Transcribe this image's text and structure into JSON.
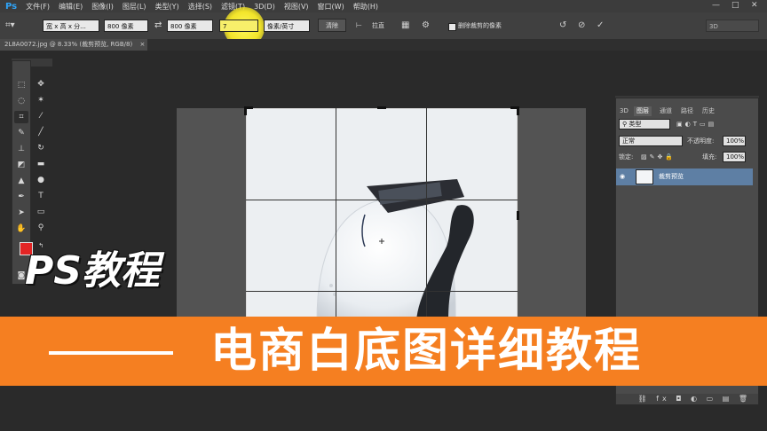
{
  "app": {
    "logo": "Ps"
  },
  "menu": [
    "文件(F)",
    "编辑(E)",
    "图像(I)",
    "图层(L)",
    "类型(Y)",
    "选择(S)",
    "滤镜(T)",
    "3D(D)",
    "视图(V)",
    "窗口(W)",
    "帮助(H)"
  ],
  "window_controls": {
    "minimize": "—",
    "maximize": "□",
    "close": "✕"
  },
  "options": {
    "ratio_select": "宽 x 高 x 分...",
    "width_value": "800 像素",
    "height_value": "800 像素",
    "resolution_value": "7",
    "unit_select": "像素/英寸",
    "clear_button": "清除",
    "straighten_label": "拉直",
    "delete_cropped_label": "删除裁剪的像素",
    "mode_3d": "3D"
  },
  "document_tab": {
    "title": "2L8A0072.jpg @ 8.33% (裁剪预览, RGB/8)",
    "close": "×"
  },
  "layers_panel": {
    "tabs": [
      "3D",
      "图层",
      "通道",
      "路径",
      "历史"
    ],
    "filter_label": "类型",
    "blend_mode": "正常",
    "opacity_label": "不透明度:",
    "opacity_value": "100%",
    "lock_label": "锁定:",
    "fill_label": "填充:",
    "fill_value": "100%",
    "layer_name": "裁剪预览",
    "bottom_icons": "⛓ fx ◘ ◐ ▭ ▤ 🗑"
  },
  "overlay": {
    "title": "PS教程",
    "banner_text": "电商白底图详细教程",
    "banner_color": "#f57f21"
  },
  "colors": {
    "accent": "#2fa3f6",
    "foreground": "#e32424",
    "highlight": "#f2e42a"
  }
}
